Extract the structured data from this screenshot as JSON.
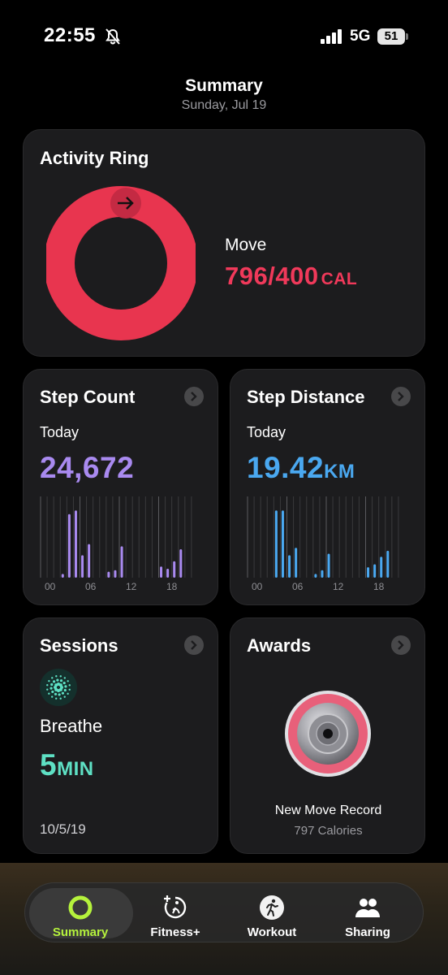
{
  "status": {
    "time": "22:55",
    "network": "5G",
    "battery": "51"
  },
  "header": {
    "title": "Summary",
    "date": "Sunday, Jul 19"
  },
  "activity": {
    "title": "Activity Ring",
    "ring_label": "Move",
    "value": "796/400",
    "unit": "CAL",
    "progress_fraction": 1.99,
    "color": "#f0395a"
  },
  "steps": {
    "title": "Step Count",
    "period": "Today",
    "value": "24,672",
    "color": "#a98af0",
    "ticks": [
      "00",
      "06",
      "12",
      "18"
    ],
    "chart_data": {
      "type": "bar",
      "x": [
        3,
        4,
        5,
        6,
        7,
        10,
        11,
        12,
        18,
        19,
        20,
        21
      ],
      "values": [
        0.05,
        0.85,
        0.9,
        0.3,
        0.45,
        0.08,
        0.1,
        0.42,
        0.15,
        0.12,
        0.22,
        0.38
      ]
    }
  },
  "distance": {
    "title": "Step Distance",
    "period": "Today",
    "value": "19.42",
    "unit": "KM",
    "color": "#4aa8f0",
    "ticks": [
      "00",
      "06",
      "12",
      "18"
    ],
    "chart_data": {
      "type": "bar",
      "x": [
        4,
        5,
        6,
        7,
        10,
        11,
        12,
        18,
        19,
        20,
        21
      ],
      "values": [
        0.9,
        0.9,
        0.3,
        0.4,
        0.05,
        0.1,
        0.32,
        0.14,
        0.18,
        0.28,
        0.36
      ]
    }
  },
  "sessions": {
    "title": "Sessions",
    "name": "Breathe",
    "value": "5",
    "unit": "MIN",
    "date": "10/5/19",
    "color": "#5ee0c4"
  },
  "awards": {
    "title": "Awards",
    "name": "New Move Record",
    "detail": "797 Calories"
  },
  "tabs": [
    {
      "label": "Summary",
      "icon": "activity-ring-icon",
      "active": true
    },
    {
      "label": "Fitness+",
      "icon": "fitness-plus-icon",
      "active": false
    },
    {
      "label": "Workout",
      "icon": "workout-icon",
      "active": false
    },
    {
      "label": "Sharing",
      "icon": "sharing-icon",
      "active": false
    }
  ]
}
